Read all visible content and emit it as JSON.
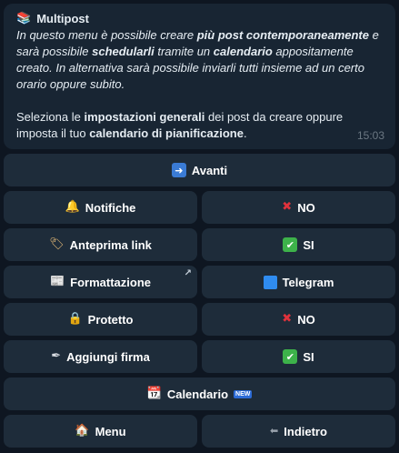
{
  "message": {
    "title": "Multipost",
    "icon": "books-icon",
    "lines": [
      {
        "parts": [
          {
            "t": "In questo menu è possibile creare ",
            "s": "i"
          },
          {
            "t": "più post contemporaneamente",
            "s": "bi"
          },
          {
            "t": " e",
            "s": "i"
          }
        ]
      },
      {
        "parts": [
          {
            "t": "sarà possibile ",
            "s": "i"
          },
          {
            "t": "schedularli",
            "s": "bi"
          },
          {
            "t": " tramite un ",
            "s": "i"
          },
          {
            "t": "calendario",
            "s": "bi"
          },
          {
            "t": " appositamente",
            "s": "i"
          }
        ]
      },
      {
        "parts": [
          {
            "t": "creato. In alternativa sarà possibile inviarli tutti insieme ad un certo",
            "s": "i"
          }
        ]
      },
      {
        "parts": [
          {
            "t": "orario oppure subito.",
            "s": "i"
          }
        ]
      },
      {
        "parts": [
          {
            "t": "",
            "s": ""
          }
        ]
      },
      {
        "parts": [
          {
            "t": "Seleziona le ",
            "s": ""
          },
          {
            "t": "impostazioni generali",
            "s": "b"
          },
          {
            "t": " dei post da creare oppure",
            "s": ""
          }
        ]
      },
      {
        "parts": [
          {
            "t": "imposta il tuo ",
            "s": ""
          },
          {
            "t": "calendario di pianificazione",
            "s": "b"
          },
          {
            "t": ".",
            "s": ""
          }
        ]
      }
    ],
    "time": "15:03"
  },
  "keyboard": {
    "avanti": "Avanti",
    "notifiche": "Notifiche",
    "notifiche_value": "NO",
    "anteprima": "Anteprima link",
    "anteprima_value": "SI",
    "formattazione": "Formattazione",
    "formattazione_value": "Telegram",
    "protetto": "Protetto",
    "protetto_value": "NO",
    "firma": "Aggiungi firma",
    "firma_value": "SI",
    "calendario": "Calendario",
    "new_badge": "NEW",
    "menu": "Menu",
    "indietro": "Indietro"
  },
  "colors": {
    "background": "#0e1621",
    "bubble": "#182533",
    "button": "#1e2c3a",
    "red_x": "#e0323c",
    "green_check": "#3db24a",
    "telegram_blue": "#2f8cf0"
  }
}
